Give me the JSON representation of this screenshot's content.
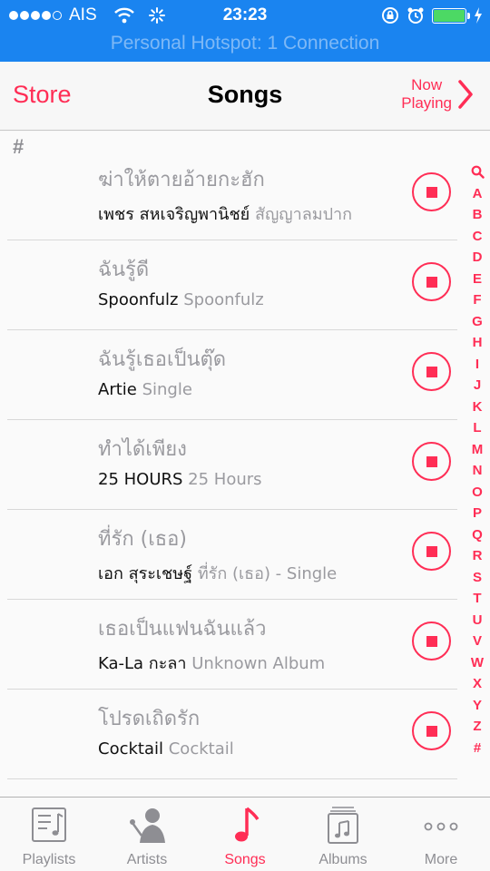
{
  "status_bar": {
    "carrier": "AIS",
    "time": "23:23",
    "hotspot": "Personal Hotspot: 1 Connection",
    "colors": {
      "background": "#1a84f0",
      "battery": "#4cd964"
    }
  },
  "nav": {
    "back_label": "Store",
    "title": "Songs",
    "now_playing_line1": "Now",
    "now_playing_line2": "Playing",
    "accent": "#ff2d55"
  },
  "list": {
    "section": "#",
    "songs": [
      {
        "title": "ฆ่าให้ตายอ้ายกะฮัก",
        "artist": "เพชร สหเจริญพานิชย์",
        "album": "สัญญาลมปาก"
      },
      {
        "title": "ฉันรู้ดี",
        "artist": "Spoonfulz",
        "album": "Spoonfulz"
      },
      {
        "title": "ฉันรู้เธอเป็นตุ๊ด",
        "artist": "Artie",
        "album": "Single"
      },
      {
        "title": "ทำได้เพียง",
        "artist": "25 HOURS",
        "album": "25 Hours"
      },
      {
        "title": "ที่รัก (เธอ)",
        "artist": "เอก สุระเชษฐ์",
        "album": "ที่รัก (เธอ)  - Single"
      },
      {
        "title": "เธอเป็นแฟนฉันแล้ว",
        "artist": "Ka-La กะลา",
        "album": "Unknown Album"
      },
      {
        "title": "โปรดเถิดรัก",
        "artist": "Cocktail",
        "album": "Cocktail"
      }
    ]
  },
  "index": [
    "Q",
    "A",
    "B",
    "C",
    "D",
    "E",
    "F",
    "G",
    "H",
    "I",
    "J",
    "K",
    "L",
    "M",
    "N",
    "O",
    "P",
    "Q",
    "R",
    "S",
    "T",
    "U",
    "V",
    "W",
    "X",
    "Y",
    "Z",
    "#"
  ],
  "tabs": [
    {
      "label": "Playlists",
      "icon": "playlists-icon"
    },
    {
      "label": "Artists",
      "icon": "artists-icon"
    },
    {
      "label": "Songs",
      "icon": "music-note-icon",
      "active": true
    },
    {
      "label": "Albums",
      "icon": "albums-icon"
    },
    {
      "label": "More",
      "icon": "more-icon"
    }
  ]
}
